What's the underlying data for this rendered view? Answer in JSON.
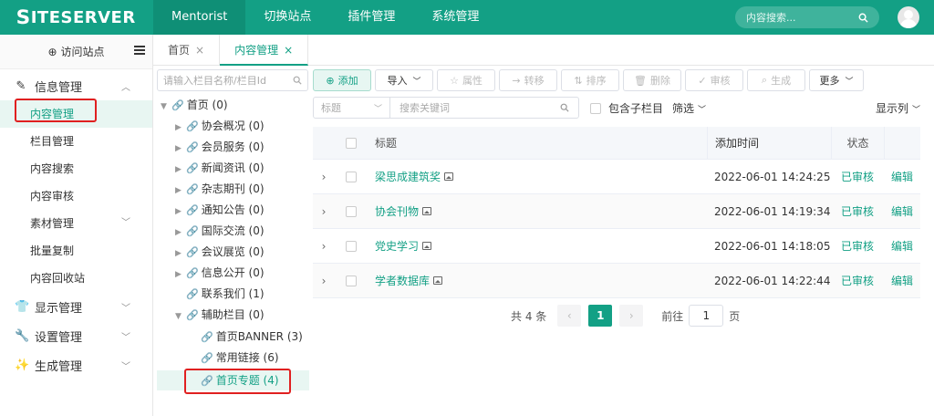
{
  "brand": {
    "logo_s": "S",
    "logo_rest": "ITESERVER"
  },
  "topnav": {
    "items": [
      "Mentorist",
      "切换站点",
      "插件管理",
      "系统管理"
    ]
  },
  "topsearch": {
    "placeholder": "内容搜索..."
  },
  "sidebar": {
    "visit": "访问站点",
    "groups": {
      "info": "信息管理",
      "display": "显示管理",
      "settings": "设置管理",
      "generate": "生成管理"
    },
    "items": [
      "内容管理",
      "栏目管理",
      "内容搜索",
      "内容审核",
      "素材管理",
      "批量复制",
      "内容回收站"
    ]
  },
  "tabs": [
    {
      "label": "首页",
      "close": "×"
    },
    {
      "label": "内容管理",
      "close": "×"
    }
  ],
  "tree": {
    "search_placeholder": "请输入栏目名称/栏目Id",
    "nodes": [
      "首页 (0)",
      "协会概况 (0)",
      "会员服务 (0)",
      "新闻资讯 (0)",
      "杂志期刊 (0)",
      "通知公告 (0)",
      "国际交流 (0)",
      "会议展览 (0)",
      "信息公开 (0)",
      "联系我们 (1)",
      "辅助栏目 (0)",
      "首页BANNER (3)",
      "常用链接 (6)",
      "首页专题 (4)"
    ]
  },
  "toolbar": {
    "add": "添加",
    "import": "导入",
    "attr": "属性",
    "transfer": "转移",
    "sort": "排序",
    "delete": "删除",
    "audit": "审核",
    "generate": "生成",
    "more": "更多"
  },
  "filter": {
    "field": "标题",
    "keyword_placeholder": "搜索关键词",
    "include_children": "包含子栏目",
    "filter": "筛选",
    "columns": "显示列"
  },
  "table": {
    "headers": {
      "title": "标题",
      "time": "添加时间",
      "status": "状态"
    },
    "rows": [
      {
        "title": "梁思成建筑奖",
        "time": "2022-06-01 14:24:25",
        "status": "已审核",
        "edit": "编辑"
      },
      {
        "title": "协会刊物",
        "time": "2022-06-01 14:19:34",
        "status": "已审核",
        "edit": "编辑"
      },
      {
        "title": "党史学习",
        "time": "2022-06-01 14:18:05",
        "status": "已审核",
        "edit": "编辑"
      },
      {
        "title": "学者数据库",
        "time": "2022-06-01 14:22:44",
        "status": "已审核",
        "edit": "编辑"
      }
    ]
  },
  "pager": {
    "total": "共 4 条",
    "current": "1",
    "goto": "前往",
    "page_value": "1",
    "page_unit": "页"
  },
  "colors": {
    "accent": "#13a085",
    "highlight": "#e02020"
  }
}
